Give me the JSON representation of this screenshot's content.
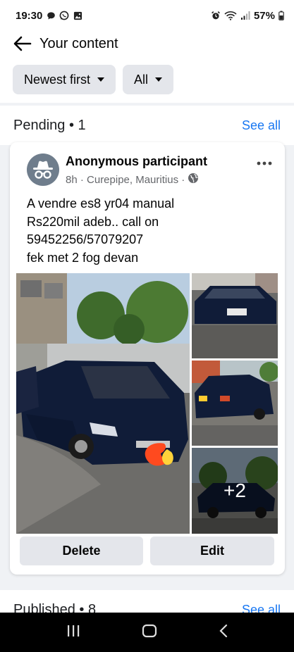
{
  "status_bar": {
    "time": "19:30",
    "battery": "57%"
  },
  "header": {
    "title": "Your content"
  },
  "filters": {
    "sort_label": "Newest first",
    "type_label": "All"
  },
  "pending": {
    "title": "Pending • 1",
    "see_all": "See all"
  },
  "post": {
    "author": "Anonymous participant",
    "meta": "8h · Curepipe, Mauritius ·",
    "text_lines": [
      "A vendre es8 yr04 manual",
      "Rs220mil adeb.. call on",
      "59452256/57079207",
      "fek met 2 fog devan"
    ],
    "extra_photos": "+2",
    "delete_label": "Delete",
    "edit_label": "Edit"
  },
  "published": {
    "title": "Published • 8",
    "see_all": "See all"
  },
  "icons": {
    "back": "arrow-left-icon",
    "more": "more-horizontal-icon",
    "globe": "globe-icon",
    "avatar": "incognito-icon",
    "nav_recents": "recents-icon",
    "nav_home": "home-icon",
    "nav_back": "back-icon"
  },
  "colors": {
    "accent": "#1877f2",
    "chip_bg": "#e4e6eb",
    "secondary_text": "#65676b"
  }
}
